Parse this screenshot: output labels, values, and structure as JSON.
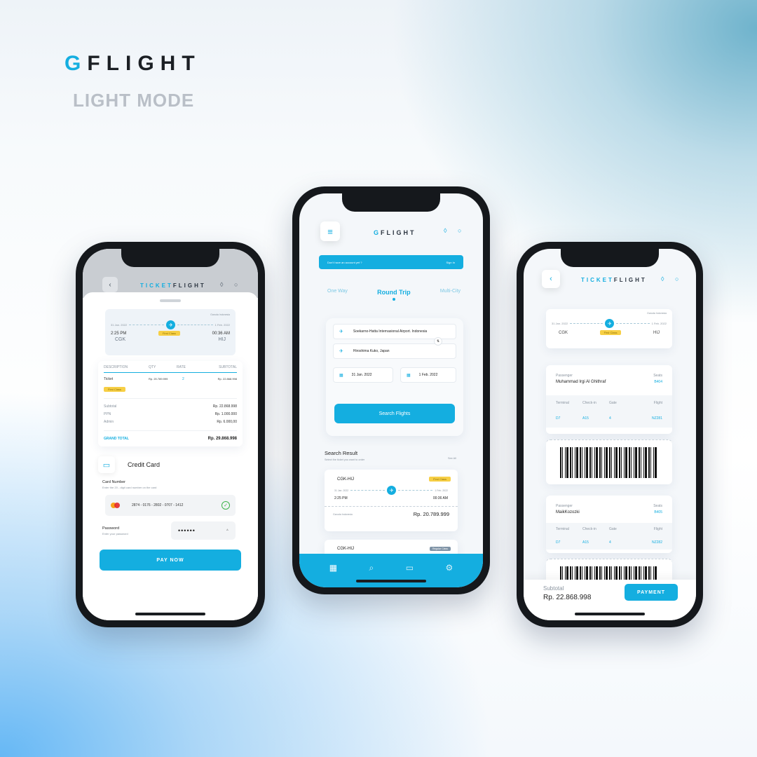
{
  "brand": {
    "g": "G",
    "rest": "FLIGHT",
    "mode": "LIGHT MODE"
  },
  "colors": {
    "accent": "#14aee0",
    "tag": "#f7cf45",
    "dark": "#15181c"
  },
  "left": {
    "header_title_ticket": "TICKET",
    "header_title_flight": "FLIGHT",
    "flight": {
      "depart_date": "31 Jan. 2022",
      "arrive_date": "1 Feb. 2022",
      "depart_time": "2:25 PM",
      "arrive_time": "00:36 AM",
      "from": "CGK",
      "to": "HIJ",
      "class_tag": "First Class",
      "airline": "Garuda Indonesia"
    },
    "table": {
      "headers": [
        "DESCRIPTION",
        "QTY",
        "RATE",
        "SUBTOTAL"
      ],
      "row": {
        "desc": "Ticket",
        "tag": "First Class",
        "qty": "Rp. 20.789.999",
        "rate": "2",
        "subtotal": "Rp. 22.868.998"
      },
      "subtotal_label": "Subtotal",
      "subtotal_value": "Rp. 22.868.998",
      "ppn_label": "PPN",
      "ppn_value": "Rp. 1.000.000",
      "admin_label": "Admin",
      "admin_value": "Rp. 6.000,00",
      "grand_label": "GRAND TOTAL",
      "grand_value": "Rp. 29.868.998"
    },
    "payment": {
      "method": "Credit Card",
      "card_label": "Card Number",
      "card_hint": "Enter the 20 - digit card number on the card",
      "card_number": "2874 - 0176 - 2802 - 0707 - 1412",
      "password_label": "Password",
      "password_hint": "Enter your password",
      "password_value": "••••••",
      "pay_button": "PAY NOW"
    }
  },
  "middle": {
    "logo_rest": "FLIGHT",
    "banner_text": "Don't have an account yet ?",
    "banner_link": "Sign In",
    "tabs": [
      "One Way",
      "Round Trip",
      "Multi-City"
    ],
    "active_tab": "Round Trip",
    "from": "Soekarno-Hatta Internasional Airport. Indonesia",
    "to": "Hiroshima Kuko, Japan",
    "depart_date": "31 Jan. 2022",
    "return_date": "1 Feb. 2022",
    "search_button": "Search Flights",
    "results_title": "Search Result",
    "results_sub": "Select the ticket you want to order",
    "see_all": "See All",
    "results": [
      {
        "route": "CGK-HIJ",
        "tag": "First Class",
        "depart_date": "31 Jan. 2022",
        "arrive_date": "1 Feb. 2022",
        "depart_time": "2:25 PM",
        "arrive_time": "00:36 AM",
        "airline": "Garuda Indonesia",
        "price": "Rp. 20.789.999"
      },
      {
        "route": "CGK-HIJ",
        "tag": "Regular Class"
      }
    ],
    "nav_icons": [
      "grid-icon",
      "search-icon",
      "ticket-icon",
      "settings-icon"
    ]
  },
  "right": {
    "header_title_ticket": "TICKET",
    "header_title_flight": "FLIGHT",
    "flight": {
      "depart_date": "31 Jan. 2022",
      "arrive_date": "1 Feb. 2022",
      "from": "CGK",
      "to": "HIJ",
      "class_tag": "First Class",
      "airline": "Garuda Indonesia"
    },
    "passengers": [
      {
        "passenger_label": "Passenger",
        "name": "Muhammad Irgi Al Ghithraf",
        "seat_label": "Seats",
        "seat": "B404",
        "terminal_label": "Terminal",
        "terminal": "D7",
        "checkin_label": "Check-in",
        "checkin": "A15",
        "gate_label": "Gate",
        "gate": "4",
        "flight_label": "Flight",
        "flight": "NZ281"
      },
      {
        "passenger_label": "Passenger",
        "name": "MaikKozozki",
        "seat_label": "Seats",
        "seat": "B405",
        "terminal_label": "Terminal",
        "terminal": "D7",
        "checkin_label": "Check-in",
        "checkin": "A15",
        "gate_label": "Gate",
        "gate": "4",
        "flight_label": "Flight",
        "flight": "NZ282"
      }
    ],
    "subtotal_label": "Subtotal",
    "subtotal_value": "Rp. 22.868.998",
    "pay_button": "PAYMENT"
  }
}
